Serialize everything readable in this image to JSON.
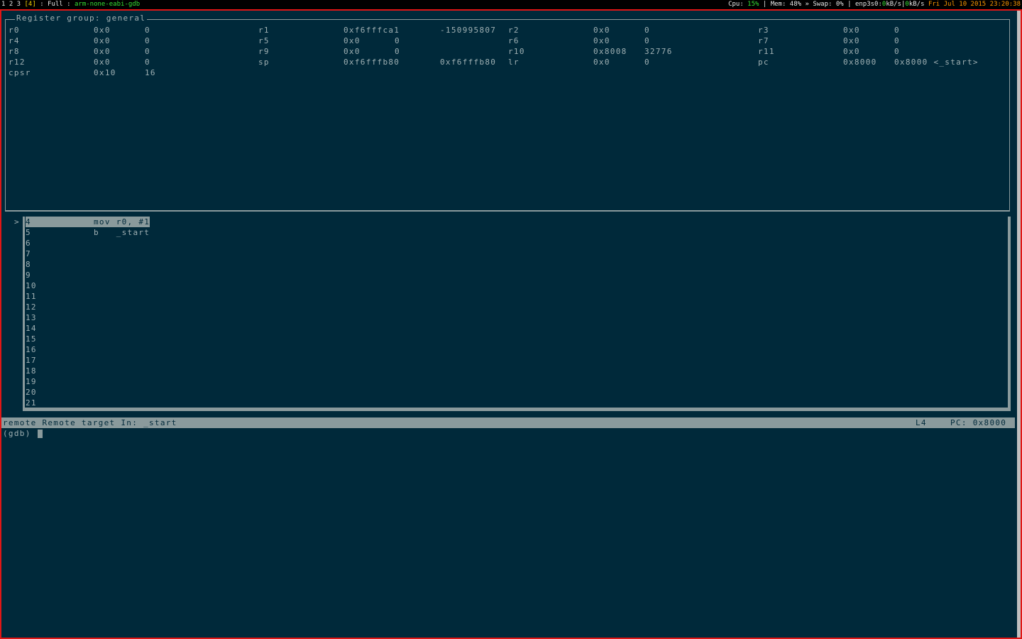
{
  "topbar": {
    "workspaces": "1 2 3",
    "active_workspace": "[4]",
    "sep1": ":",
    "layout": "Full",
    "sep2": ":",
    "window_title": "arm-none-eabi-gdb",
    "cpu_label": "Cpu:",
    "cpu_value": "15%",
    "mem_label": "| Mem:",
    "mem_value": "48%",
    "swap_label": "» Swap:",
    "swap_value": "0%",
    "net_label": "| enp3s0:",
    "net_down": "0",
    "net_down_unit": "kB/s",
    "net_sep": "|",
    "net_up": "0",
    "net_up_unit": "kB/s",
    "datetime": "Fri Jul 10 2015 23:20:38"
  },
  "registers": {
    "title": "Register group: general",
    "rows": [
      [
        {
          "name": "r0",
          "hex": "0x0",
          "dec": "0"
        },
        {
          "name": "r1",
          "hex": "0xf6fffca1",
          "dec": "-150995807"
        },
        {
          "name": "r2",
          "hex": "0x0",
          "dec": "0"
        },
        {
          "name": "r3",
          "hex": "0x0",
          "dec": "0"
        }
      ],
      [
        {
          "name": "r4",
          "hex": "0x0",
          "dec": "0"
        },
        {
          "name": "r5",
          "hex": "0x0",
          "dec": "0"
        },
        {
          "name": "r6",
          "hex": "0x0",
          "dec": "0"
        },
        {
          "name": "r7",
          "hex": "0x0",
          "dec": "0"
        }
      ],
      [
        {
          "name": "r8",
          "hex": "0x0",
          "dec": "0"
        },
        {
          "name": "r9",
          "hex": "0x0",
          "dec": "0"
        },
        {
          "name": "r10",
          "hex": "0x8008",
          "dec": "32776"
        },
        {
          "name": "r11",
          "hex": "0x0",
          "dec": "0"
        }
      ],
      [
        {
          "name": "r12",
          "hex": "0x0",
          "dec": "0"
        },
        {
          "name": "sp",
          "hex": "0xf6fffb80",
          "dec": "0xf6fffb80"
        },
        {
          "name": "lr",
          "hex": "0x0",
          "dec": "0"
        },
        {
          "name": "pc",
          "hex": "0x8000",
          "dec": "0x8000 <_start>"
        }
      ],
      [
        {
          "name": "cpsr",
          "hex": "0x10",
          "dec": "16"
        }
      ]
    ]
  },
  "source": {
    "pointer": ">",
    "lines": [
      {
        "num": "4",
        "code": "mov r0, #1"
      },
      {
        "num": "5",
        "code": "b   _start"
      },
      {
        "num": "6",
        "code": ""
      },
      {
        "num": "7",
        "code": ""
      },
      {
        "num": "8",
        "code": ""
      },
      {
        "num": "9",
        "code": ""
      },
      {
        "num": "10",
        "code": ""
      },
      {
        "num": "11",
        "code": ""
      },
      {
        "num": "12",
        "code": ""
      },
      {
        "num": "13",
        "code": ""
      },
      {
        "num": "14",
        "code": ""
      },
      {
        "num": "15",
        "code": ""
      },
      {
        "num": "16",
        "code": ""
      },
      {
        "num": "17",
        "code": ""
      },
      {
        "num": "18",
        "code": ""
      },
      {
        "num": "19",
        "code": ""
      },
      {
        "num": "20",
        "code": ""
      },
      {
        "num": "21",
        "code": ""
      }
    ]
  },
  "status": {
    "left": "remote Remote target In: _start",
    "line": "L4",
    "pc": "PC: 0x8000"
  },
  "console": {
    "prompt": "(gdb) "
  },
  "colors": {
    "background": "#00293a",
    "foreground": "#9fb0b3",
    "border": "#e01616",
    "highlight": "#8a9a9c"
  }
}
